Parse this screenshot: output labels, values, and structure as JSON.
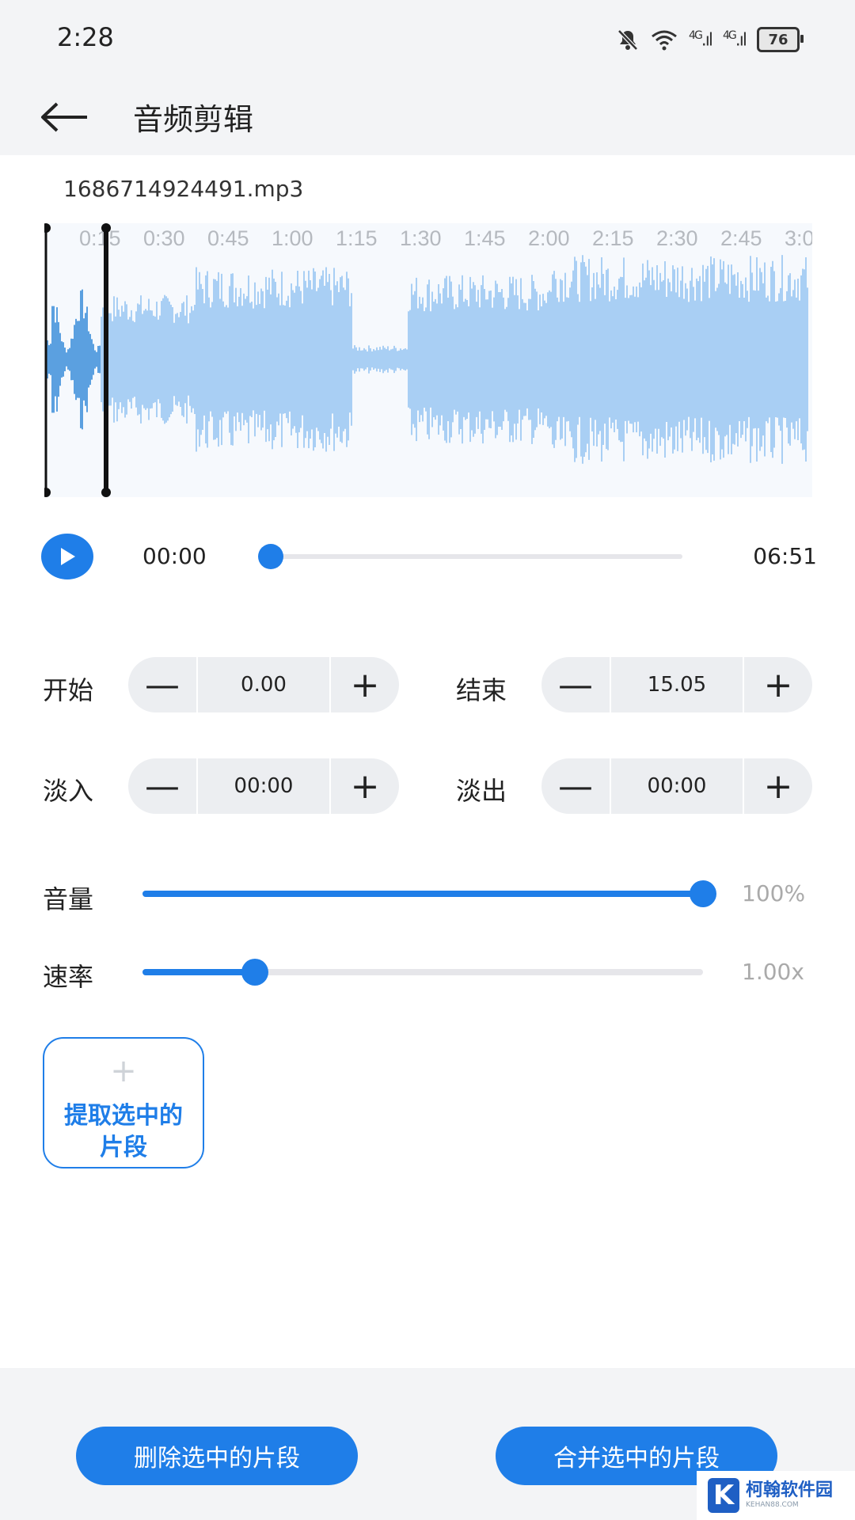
{
  "status_bar": {
    "time": "2:28",
    "network_1": "4G",
    "network_2": "4G",
    "battery": "76",
    "icons": [
      "bell-muted-icon",
      "wifi-icon",
      "signal-icon",
      "signal-icon",
      "battery-icon"
    ]
  },
  "app_bar": {
    "back_icon": "arrow-left-icon",
    "title": "音频剪辑"
  },
  "waveform": {
    "file_name": "1686714924491.mp3",
    "ticks": [
      "0:15",
      "0:30",
      "0:45",
      "1:00",
      "1:15",
      "1:30",
      "1:45",
      "2:00",
      "2:15",
      "2:30",
      "2:45",
      "3:0"
    ],
    "colors": {
      "selected": "#5ba0e0",
      "unselected": "#a9cff4",
      "handle": "#111111"
    }
  },
  "player": {
    "current_time": "00:00",
    "total_time": "06:51",
    "progress_fraction": 0.0
  },
  "trim": {
    "start_label": "开始",
    "start_value": "0.00",
    "end_label": "结束",
    "end_value": "15.05",
    "fade_in_label": "淡入",
    "fade_in_value": "00:00",
    "fade_out_label": "淡出",
    "fade_out_value": "00:00",
    "minus": "—",
    "plus": "+"
  },
  "volume": {
    "label": "音量",
    "value_text": "100%",
    "fraction": 1.0
  },
  "speed": {
    "label": "速率",
    "value_text": "1.00x",
    "fraction": 0.2
  },
  "extract": {
    "plus": "+",
    "label": "提取选中的片段"
  },
  "actions": {
    "delete_label": "删除选中的片段",
    "merge_label": "合并选中的片段"
  },
  "watermark": {
    "logo": "K",
    "text": "柯翰软件园",
    "sub": "KEHAN88.COM"
  },
  "theme": {
    "accent": "#1f7ee8",
    "surface": "#f3f4f6"
  }
}
